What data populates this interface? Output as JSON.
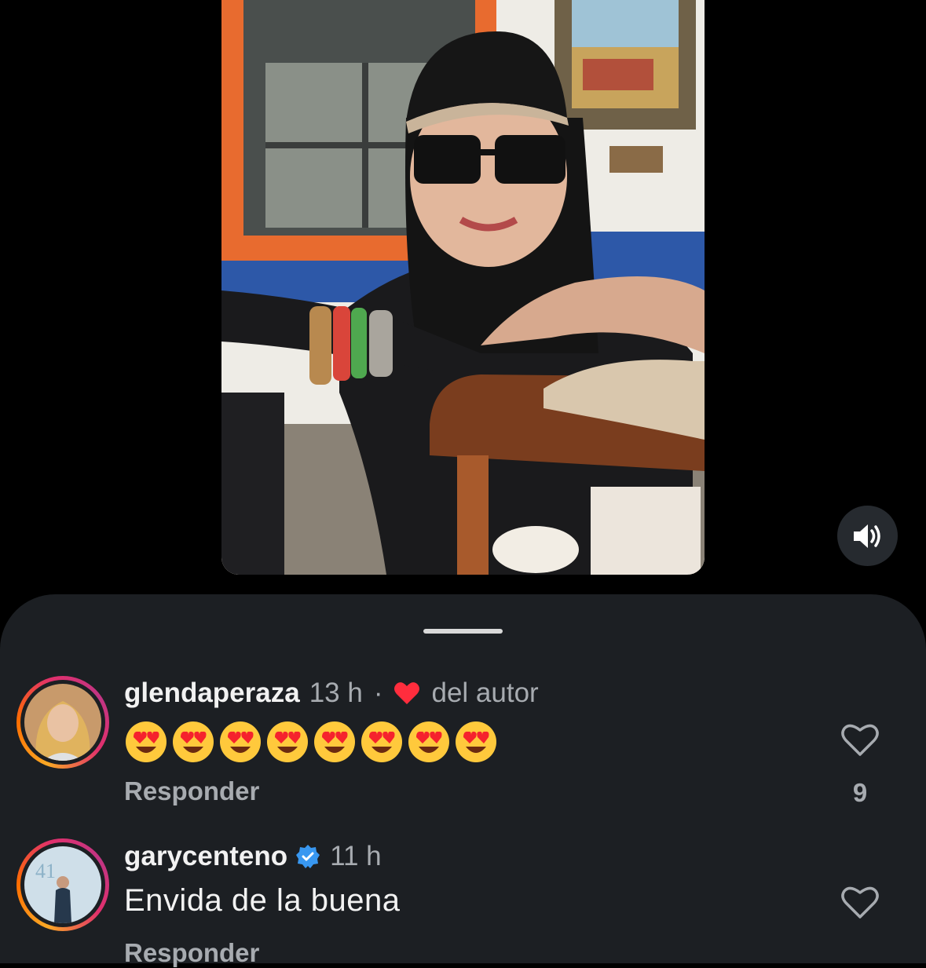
{
  "video": {
    "audio_icon": "speaker-wave-icon"
  },
  "comments": [
    {
      "username": "glendaperaza",
      "time": "13 h",
      "separator": "·",
      "author_like_label": "del autor",
      "emoji": "😍😍😍😍😍😍😍😍",
      "reply_label": "Responder",
      "like_count": "9"
    },
    {
      "username": "garycenteno",
      "verified": true,
      "time": "11 h",
      "text": "Envida de la buena",
      "reply_label": "Responder"
    }
  ],
  "colors": {
    "sheet_bg": "#1c1f23",
    "secondary_text": "#a7abb0",
    "author_heart": "#ff2d3d",
    "verified_badge": "#3897f0"
  }
}
